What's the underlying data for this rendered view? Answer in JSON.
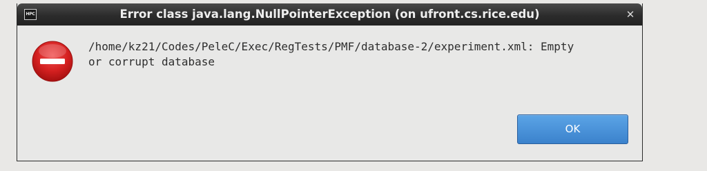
{
  "window": {
    "title": "Error class java.lang.NullPointerException  (on ufront.cs.rice.edu)",
    "app_icon_text": "HPC",
    "close_glyph": "✕"
  },
  "dialog": {
    "icon": "error-stop-icon",
    "message": "/home/kz21/Codes/PeleC/Exec/RegTests/PMF/database-2/experiment.xml: Empty\nor corrupt database",
    "ok_label": "OK"
  },
  "colors": {
    "titlebar": "#2c2c2c",
    "dialog_bg": "#e8e8e7",
    "ok_button": "#4a92da",
    "error_red": "#d42020"
  }
}
